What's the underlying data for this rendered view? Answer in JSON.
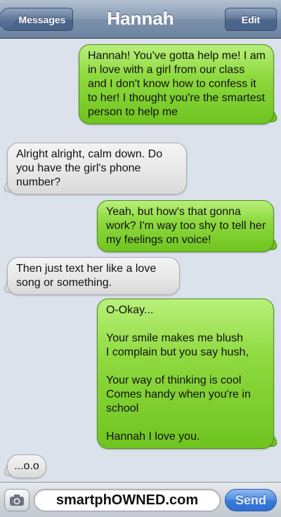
{
  "navbar": {
    "back_label": "Messages",
    "title": "Hannah",
    "edit_label": "Edit"
  },
  "messages": [
    {
      "from": "me",
      "text": "Hannah! You've gotta help me! I am in love with a girl from our class and I don't know how to confess it to her! I thought you're the smartest person to help me"
    },
    {
      "from": "Hannah",
      "text": "Alright alright, calm down. Do you have the girl's phone number?"
    },
    {
      "from": "me",
      "text": "Yeah, but how's that gonna work? I'm way too shy to tell her my feelings on voice!"
    },
    {
      "from": "Hannah",
      "text": "Then just text her like a love song or something."
    },
    {
      "from": "me",
      "text": "O-Okay...\n\nYour smile makes me blush\nI complain but you say hush,\n\nYour way of thinking is cool\nComes handy when you're in school\n\nHannah I love you."
    },
    {
      "from": "Hannah",
      "text": "...o.o"
    }
  ],
  "input_bar": {
    "camera_icon": "camera-icon",
    "field_text": "smartphOWNED.com",
    "send_label": "Send"
  },
  "colors": {
    "sent_bubble": "#8ed93f",
    "received_bubble": "#e6e6e6",
    "background": "#dbe2ec",
    "send_button": "#4f8ce3"
  }
}
